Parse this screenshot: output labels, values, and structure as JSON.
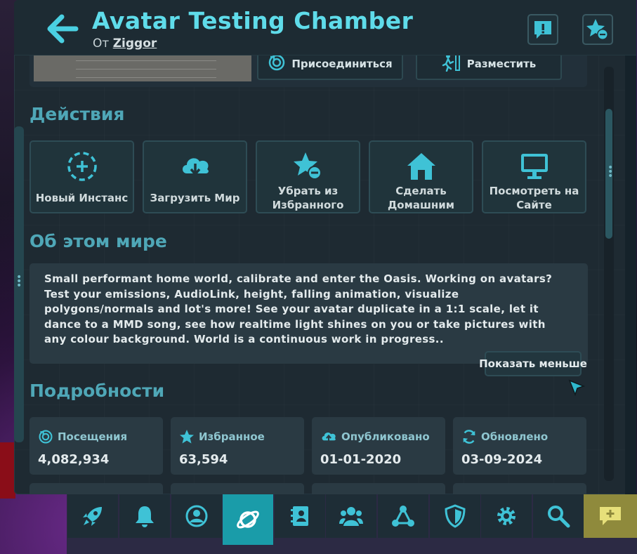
{
  "header": {
    "title": "Avatar Testing Chamber",
    "by_prefix": "От",
    "author": "Ziggor"
  },
  "top_actions": {
    "join": "Присоединиться",
    "place": "Разместить"
  },
  "actions": {
    "title": "Действия",
    "items": [
      {
        "label": "Новый Инстанс",
        "icon": "new-instance-icon"
      },
      {
        "label": "Загрузить Мир",
        "icon": "cloud-download-icon"
      },
      {
        "label": "Убрать из Избранного",
        "icon": "unfavorite-icon"
      },
      {
        "label": "Сделать Домашним",
        "icon": "home-icon"
      },
      {
        "label": "Посмотреть на Сайте",
        "icon": "monitor-icon"
      }
    ]
  },
  "about": {
    "title": "Об этом мире",
    "description": "Small performant home world, calibrate and enter the Oasis. Working on avatars? Test your emissions, AudioLink, height, falling animation, visualize polygons/normals and lot's more! See your avatar duplicate in a 1:1 scale, let it dance to a MMD song, see how realtime light shines on you or take pictures with any colour background. World is a continuous work in progress..",
    "show_less": "Показать меньше"
  },
  "details": {
    "title": "Подробности",
    "stats": [
      {
        "label": "Посещения",
        "value": "4,082,934",
        "icon": "visits-icon"
      },
      {
        "label": "Избранное",
        "value": "63,594",
        "icon": "star-icon"
      },
      {
        "label": "Опубликовано",
        "value": "01-01-2020",
        "icon": "cloud-upload-icon"
      },
      {
        "label": "Обновлено",
        "value": "03-09-2024",
        "icon": "refresh-icon"
      }
    ]
  },
  "colors": {
    "accent": "#4ad0e2",
    "panel": "#1e2a32",
    "active_tab": "#1a9ca9",
    "chat": "#8f8a3c"
  },
  "nav": [
    {
      "name": "launch",
      "icon": "rocket-icon"
    },
    {
      "name": "notifications",
      "icon": "bell-icon"
    },
    {
      "name": "profile",
      "icon": "user-circle-icon"
    },
    {
      "name": "worlds",
      "icon": "planet-icon",
      "active": true
    },
    {
      "name": "avatars",
      "icon": "avatar-book-icon"
    },
    {
      "name": "social",
      "icon": "people-icon"
    },
    {
      "name": "groups",
      "icon": "network-icon"
    },
    {
      "name": "safety",
      "icon": "shield-icon"
    },
    {
      "name": "settings",
      "icon": "gear-icon"
    },
    {
      "name": "search",
      "icon": "search-icon"
    },
    {
      "name": "chat",
      "icon": "chat-add-icon"
    }
  ]
}
